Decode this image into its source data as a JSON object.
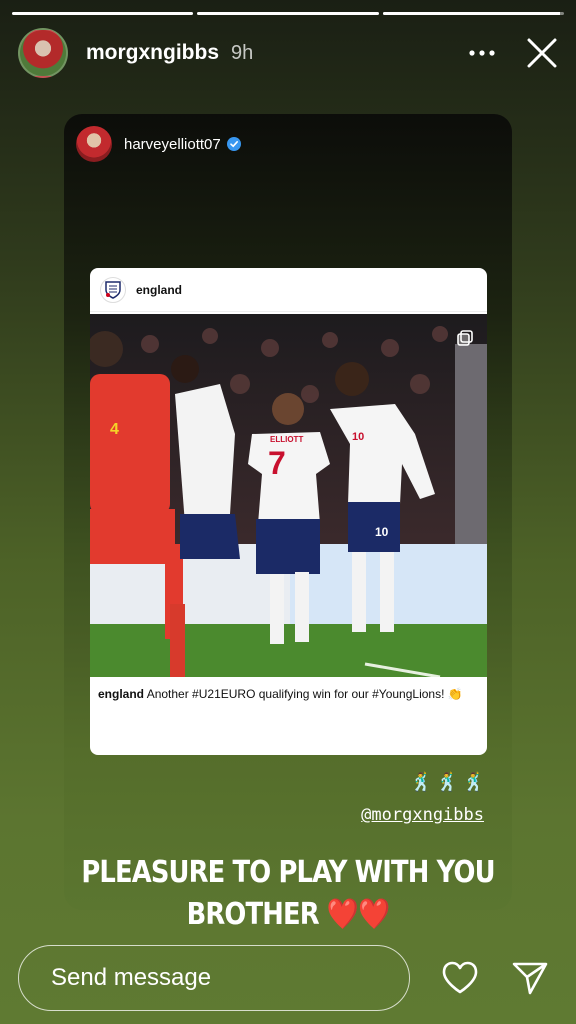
{
  "story": {
    "progress": [
      1,
      1,
      0.98
    ],
    "username": "morgxngibbs",
    "time": "9h"
  },
  "shared": {
    "username": "harveyelliott07",
    "post": {
      "account": "england",
      "caption_user": "england",
      "caption_text": "Another #U21EURO qualifying win for our #YoungLions! 👏"
    }
  },
  "sticker": {
    "emojis": "🕺🕺🕺",
    "mention": "@morgxngibbs",
    "text_line1": "PLEASURE TO PLAY WITH YOU",
    "text_line2": "BROTHER",
    "hearts": "❤️❤️"
  },
  "footer": {
    "message_placeholder": "Send message"
  },
  "photo": {
    "players": [
      {
        "number": "4",
        "shirt": "ANDORRA-RED"
      },
      {
        "number": "7",
        "name": "ELLIOTT"
      },
      {
        "number": "10"
      }
    ]
  }
}
